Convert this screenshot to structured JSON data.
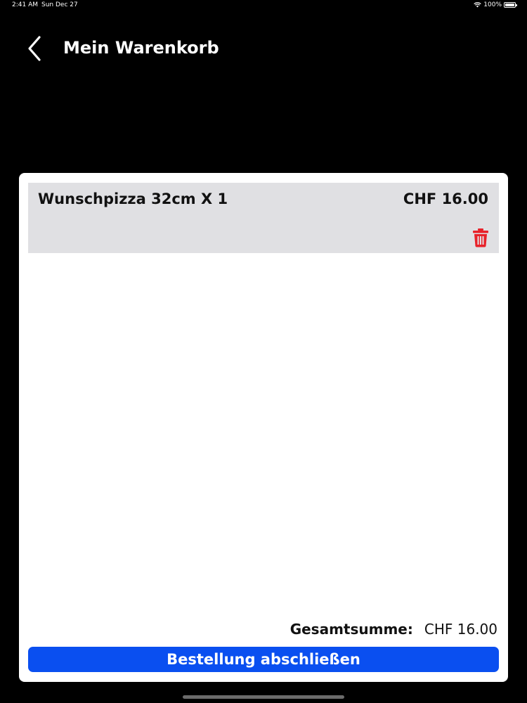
{
  "status_bar": {
    "time": "2:41 AM",
    "date": "Sun Dec 27",
    "battery": "100%",
    "wifi_icon": "wifi-icon",
    "battery_icon": "battery-icon"
  },
  "header": {
    "back_icon": "chevron-left-icon",
    "title": "Mein Warenkorb"
  },
  "cart": {
    "items": [
      {
        "name": "Wunschpizza 32cm X 1",
        "price": "CHF 16.00",
        "delete_icon": "trash-icon",
        "delete_color": "#e8222a"
      }
    ],
    "total_label": "Gesamtsumme:",
    "total_value": "CHF 16.00",
    "checkout_label": "Bestellung abschließen"
  },
  "colors": {
    "background": "#000000",
    "card": "#ffffff",
    "item_background": "#e0e0e3",
    "primary_button": "#0a4ff0",
    "delete": "#e8222a"
  }
}
